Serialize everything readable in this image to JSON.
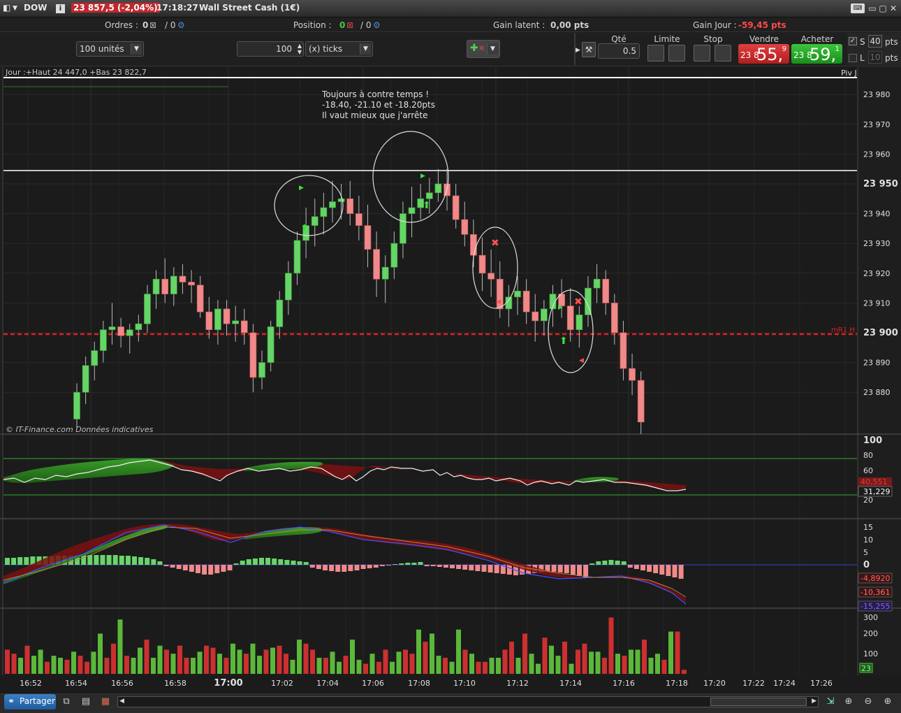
{
  "window": {
    "symbol": "DOW",
    "price": "23 857,5",
    "change": "(-2,04%)",
    "time": "17:18:27",
    "instrument": "Wall Street Cash (1€)"
  },
  "summary": {
    "orders_label": "Ordres :",
    "orders_value": "0",
    "orders_alt": "/ 0",
    "position_label": "Position :",
    "position_value": "0",
    "position_alt": "/ 0",
    "latent_label": "Gain latent :",
    "latent_value": "0,00 pts",
    "day_label": "Gain Jour :",
    "day_value": "-59,45 pts"
  },
  "trade": {
    "units": "100 unités",
    "ticks_value": "100",
    "ticks_unit": "(x) ticks",
    "qty_label": "Qté",
    "qty_value": "0.5",
    "limit_label": "Limite",
    "stop_label": "Stop",
    "sell_label": "Vendre",
    "buy_label": "Acheter",
    "sell_prefix": "23 8",
    "sell_big": "55,",
    "sell_sup": "9",
    "buy_prefix": "23 8",
    "buy_big": "59,",
    "buy_sup": "1",
    "s_label": "S",
    "s_value": "40",
    "s_unit": "pts",
    "l_label": "L",
    "l_value": "10",
    "l_unit": "pts"
  },
  "chart_data": {
    "type": "candlestick",
    "info": "Jour :+Haut 24 447,0 +Bas 23 822,7",
    "pivot_label": "Piv J",
    "mr1_label": "mR1 H",
    "watermark": "© IT-Finance.com Données indicatives",
    "annotation": [
      "Toujours à contre temps !",
      "-18.40, -21.10 et -18.20pts",
      "Il vaut mieux que j'arrête"
    ],
    "price_ticks": [
      "23 980",
      "23 970",
      "23 960",
      "23 950",
      "23 940",
      "23 930",
      "23 920",
      "23 910",
      "23 900",
      "23 890",
      "23 880"
    ],
    "bold_ticks": [
      "23 950",
      "23 900"
    ],
    "time_ticks": [
      "16:52",
      "16:54",
      "16:56",
      "16:58",
      "17:00",
      "17:02",
      "17:04",
      "17:06",
      "17:08",
      "17:10",
      "17:12",
      "17:14",
      "17:16",
      "17:18",
      "17:20",
      "17:22",
      "17:24",
      "17:26"
    ],
    "osc_ticks": [
      "100",
      "80",
      "60",
      "40",
      "20"
    ],
    "osc_label": "31,229",
    "osc_label2": "40,551",
    "macd_ticks": [
      "15",
      "10",
      "5",
      "0"
    ],
    "macd_labels": [
      "-4,8920",
      "-10,361",
      "-15,255"
    ],
    "volume_ticks": [
      "300",
      "200",
      "100"
    ],
    "volume_label": "23",
    "candles": [
      [
        23871,
        23883,
        23868,
        23880
      ],
      [
        23880,
        23892,
        23876,
        23889
      ],
      [
        23889,
        23897,
        23884,
        23894
      ],
      [
        23894,
        23904,
        23890,
        23901
      ],
      [
        23901,
        23910,
        23896,
        23902
      ],
      [
        23902,
        23905,
        23895,
        23899
      ],
      [
        23899,
        23903,
        23893,
        23901
      ],
      [
        23901,
        23906,
        23897,
        23903
      ],
      [
        23903,
        23916,
        23900,
        23913
      ],
      [
        23913,
        23921,
        23908,
        23918
      ],
      [
        23918,
        23925,
        23910,
        23913
      ],
      [
        23913,
        23922,
        23909,
        23919
      ],
      [
        23919,
        23923,
        23913,
        23917
      ],
      [
        23917,
        23921,
        23910,
        23916
      ],
      [
        23916,
        23919,
        23905,
        23907
      ],
      [
        23907,
        23912,
        23898,
        23901
      ],
      [
        23901,
        23911,
        23896,
        23908
      ],
      [
        23908,
        23911,
        23899,
        23903
      ],
      [
        23903,
        23909,
        23897,
        23904
      ],
      [
        23904,
        23908,
        23896,
        23900
      ],
      [
        23900,
        23903,
        23880,
        23885
      ],
      [
        23885,
        23894,
        23881,
        23890
      ],
      [
        23890,
        23904,
        23887,
        23902
      ],
      [
        23902,
        23914,
        23898,
        23911
      ],
      [
        23911,
        23924,
        23906,
        23920
      ],
      [
        23920,
        23934,
        23916,
        23931
      ],
      [
        23931,
        23942,
        23925,
        23936
      ],
      [
        23936,
        23945,
        23929,
        23939
      ],
      [
        23939,
        23947,
        23933,
        23942
      ],
      [
        23942,
        23951,
        23937,
        23944
      ],
      [
        23944,
        23950,
        23938,
        23945
      ],
      [
        23945,
        23951,
        23936,
        23940
      ],
      [
        23940,
        23946,
        23931,
        23936
      ],
      [
        23936,
        23943,
        23922,
        23928
      ],
      [
        23928,
        23934,
        23912,
        23918
      ],
      [
        23918,
        23926,
        23910,
        23922
      ],
      [
        23922,
        23934,
        23918,
        23930
      ],
      [
        23930,
        23944,
        23925,
        23940
      ],
      [
        23940,
        23949,
        23932,
        23942
      ],
      [
        23942,
        23950,
        23938,
        23945
      ],
      [
        23945,
        23952,
        23940,
        23947
      ],
      [
        23947,
        23955,
        23944,
        23950
      ],
      [
        23950,
        23955,
        23941,
        23946
      ],
      [
        23946,
        23950,
        23935,
        23938
      ],
      [
        23938,
        23944,
        23929,
        23933
      ],
      [
        23933,
        23938,
        23922,
        23926
      ],
      [
        23926,
        23932,
        23914,
        23920
      ],
      [
        23920,
        23928,
        23912,
        23918
      ],
      [
        23918,
        23924,
        23905,
        23908
      ],
      [
        23908,
        23916,
        23902,
        23912
      ],
      [
        23912,
        23919,
        23906,
        23914
      ],
      [
        23914,
        23918,
        23903,
        23907
      ],
      [
        23907,
        23913,
        23897,
        23904
      ],
      [
        23904,
        23911,
        23899,
        23908
      ],
      [
        23908,
        23916,
        23902,
        23913
      ],
      [
        23913,
        23918,
        23905,
        23909
      ],
      [
        23909,
        23915,
        23897,
        23901
      ],
      [
        23901,
        23909,
        23895,
        23906
      ],
      [
        23906,
        23919,
        23902,
        23915
      ],
      [
        23915,
        23923,
        23910,
        23918
      ],
      [
        23918,
        23921,
        23906,
        23910
      ],
      [
        23910,
        23913,
        23896,
        23900
      ],
      [
        23900,
        23904,
        23884,
        23888
      ],
      [
        23888,
        23893,
        23879,
        23884
      ],
      [
        23884,
        23887,
        23866,
        23870
      ]
    ]
  }
}
